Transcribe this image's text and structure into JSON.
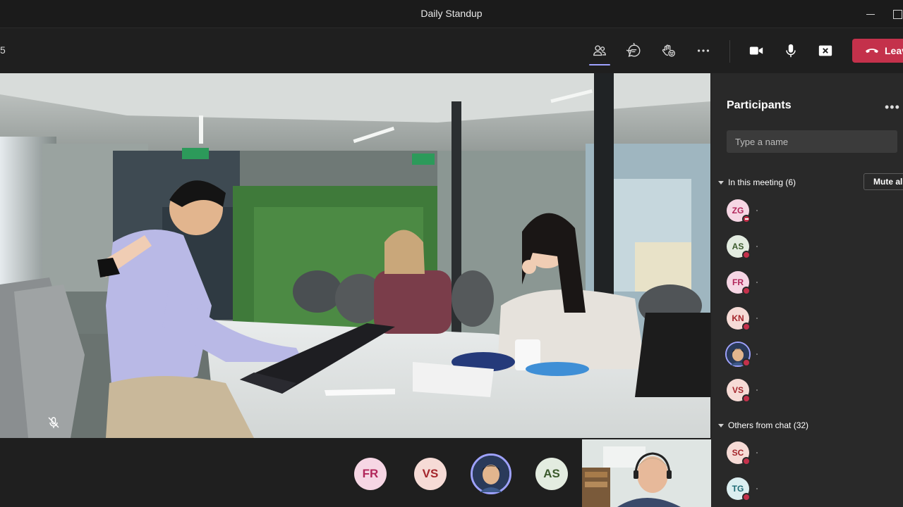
{
  "window": {
    "title": "Daily Standup"
  },
  "toolbar": {
    "timer": "5",
    "buttons": [
      {
        "name": "participants-button",
        "icon": "people-icon",
        "active": true
      },
      {
        "name": "chat-button",
        "icon": "chat-bubble-icon"
      },
      {
        "name": "reactions-button",
        "icon": "raise-hand-icon"
      },
      {
        "name": "more-actions-button",
        "icon": "more-dots-icon"
      },
      {
        "name": "camera-button",
        "icon": "video-camera-icon"
      },
      {
        "name": "mic-button",
        "icon": "microphone-icon"
      },
      {
        "name": "share-button",
        "icon": "share-tray-icon"
      }
    ],
    "leave_label": "Leave",
    "leave_color": "#c4314b"
  },
  "main_video": {
    "muted": true,
    "mute_icon": "mic-off-icon"
  },
  "strip": {
    "avatars": [
      {
        "initials": "FR",
        "bg": "#f6d6e4",
        "fg": "#b1265a"
      },
      {
        "initials": "VS",
        "bg": "#f6dbd6",
        "fg": "#a4262c"
      },
      {
        "initials": "",
        "photo": true,
        "bg": "#2a3a5a"
      },
      {
        "initials": "AS",
        "bg": "#e3ece0",
        "fg": "#3b5a2c"
      }
    ],
    "self_view": true
  },
  "panel": {
    "title": "Participants",
    "search_placeholder": "Type a name",
    "in_meeting_label": "In this meeting (6)",
    "mute_all_label": "Mute all",
    "others_label": "Others from chat (32)",
    "in_meeting": [
      {
        "initials": "ZG",
        "bg": "#f6d6e4",
        "fg": "#b1265a",
        "status": "dnd"
      },
      {
        "initials": "AS",
        "bg": "#e3ece0",
        "fg": "#3b5a2c",
        "status": "busy"
      },
      {
        "initials": "FR",
        "bg": "#f6d6e4",
        "fg": "#b1265a",
        "status": "busy"
      },
      {
        "initials": "KN",
        "bg": "#f6dbd6",
        "fg": "#a4262c",
        "status": "busy"
      },
      {
        "initials": "",
        "photo": true,
        "bg": "#2a3a5a",
        "status": "busy"
      },
      {
        "initials": "VS",
        "bg": "#f6dbd6",
        "fg": "#a4262c",
        "status": "busy"
      }
    ],
    "others": [
      {
        "initials": "SC",
        "bg": "#f6dbd6",
        "fg": "#a4262c",
        "status": "busy"
      },
      {
        "initials": "TG",
        "bg": "#dbeef0",
        "fg": "#1f6b75",
        "status": "busy"
      }
    ]
  }
}
